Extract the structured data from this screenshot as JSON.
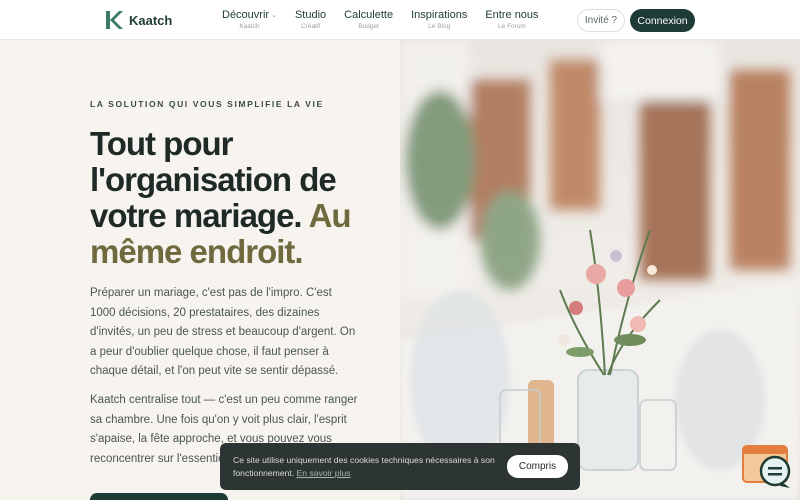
{
  "header": {
    "brand": "Kaatch",
    "nav": [
      {
        "label": "Découvrir",
        "sub": "Kaatch",
        "has_chevron": true
      },
      {
        "label": "Studio",
        "sub": "Créatif",
        "has_chevron": false
      },
      {
        "label": "Calculette",
        "sub": "Budget",
        "has_chevron": false
      },
      {
        "label": "Inspirations",
        "sub": "Le Blog",
        "has_chevron": false
      },
      {
        "label": "Entre nous",
        "sub": "Le Forum",
        "has_chevron": false
      }
    ],
    "guest_label": "Invité ?",
    "login_label": "Connexion"
  },
  "hero": {
    "eyebrow": "LA SOLUTION QUI VOUS SIMPLIFIE LA VIE",
    "headline_main": "Tout pour l'organisation de votre mariage.",
    "headline_accent": "Au même endroit.",
    "paragraph_1": "Préparer un mariage, c'est pas de l'impro. C'est 1000 décisions, 20 prestataires, des dizaines d'invités, un peu de stress et beaucoup d'argent. On a peur d'oublier quelque chose, il faut penser à chaque détail, et l'on peut vite se sentir dépassé.",
    "paragraph_2": "Kaatch centralise tout — c'est un peu comme ranger sa chambre. Une fois qu'on y voit plus clair, l'esprit s'apaise, la fête approche, et vous pouvez vous reconcentrer sur l'essentiel"
  },
  "cookie": {
    "text": "Ce site utilise uniquement des cookies techniques nécessaires à son fonctionnement.",
    "link": "En savoir plus",
    "accept_label": "Compris"
  },
  "colors": {
    "brand_green": "#1f3b35",
    "accent_olive": "#6f6a3e",
    "background": "#f7f4f0",
    "cookie_bg": "#2c3533"
  },
  "icons": [
    "kaatch-logo-icon",
    "chevron-down-icon",
    "chat-icon"
  ]
}
